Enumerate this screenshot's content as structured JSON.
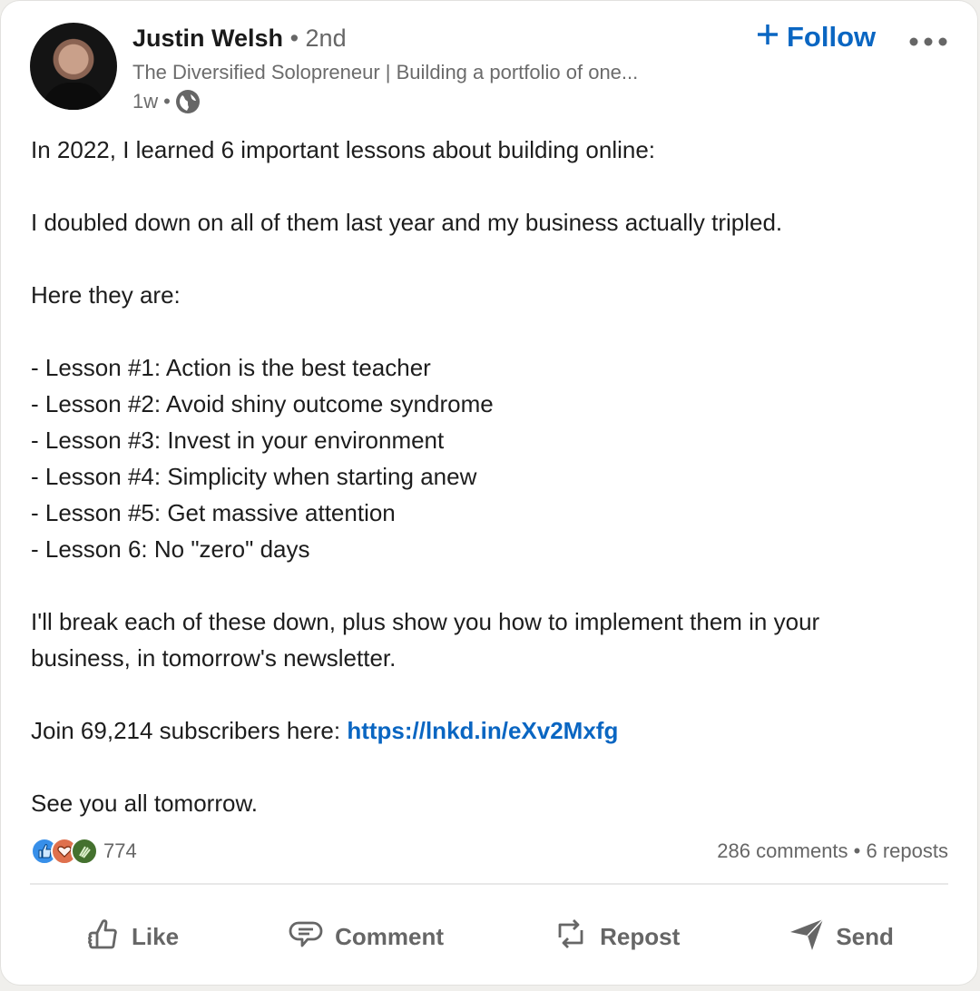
{
  "author": {
    "name": "Justin Welsh",
    "degree": "2nd",
    "headline": "The Diversified Solopreneur | Building a portfolio of one...",
    "time": "1w",
    "visibility_icon": "globe-icon"
  },
  "header": {
    "follow_label": "Follow",
    "follow_icon": "plus-icon",
    "more_icon": "ellipsis-icon",
    "separator": "•"
  },
  "post": {
    "paragraphs": [
      "In 2022, I learned 6 important lessons about building online:",
      "I doubled down on all of them last year and my business actually tripled.",
      "Here they are:"
    ],
    "lessons": [
      "- Lesson #1: Action is the best teacher",
      "- Lesson #2: Avoid shiny outcome syndrome",
      "- Lesson #3: Invest in your environment",
      "- Lesson #4: Simplicity when starting anew",
      "- Lesson #5: Get massive attention",
      "- Lesson 6: No \"zero\" days"
    ],
    "closing_lines": [
      "I'll break each of these down, plus show you how to implement them in your",
      "business, in tomorrow's newsletter."
    ],
    "join_text": "Join 69,214 subscribers here: ",
    "link_text": "https://lnkd.in/eXv2Mxfg",
    "signoff": "See you all tomorrow."
  },
  "social": {
    "reaction_icons": [
      "like-reaction-icon",
      "love-reaction-icon",
      "celebrate-reaction-icon"
    ],
    "reaction_count": "774",
    "comments": "286 comments",
    "reposts": "6 reposts",
    "separator": "•"
  },
  "actions": [
    {
      "label": "Like",
      "icon": "thumbs-up-icon"
    },
    {
      "label": "Comment",
      "icon": "comment-icon"
    },
    {
      "label": "Repost",
      "icon": "repost-icon"
    },
    {
      "label": "Send",
      "icon": "send-icon"
    }
  ],
  "colors": {
    "brand": "#0a66c2",
    "text": "#1d1d1d",
    "muted": "#666666"
  }
}
